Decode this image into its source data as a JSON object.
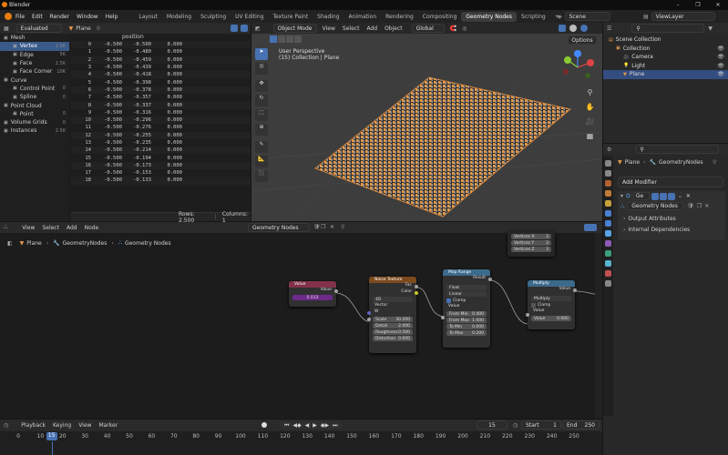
{
  "window": {
    "title": "Blender"
  },
  "menu": [
    "File",
    "Edit",
    "Render",
    "Window",
    "Help"
  ],
  "workspaces": [
    "Layout",
    "Modeling",
    "Sculpting",
    "UV Editing",
    "Texture Paint",
    "Shading",
    "Animation",
    "Rendering",
    "Compositing",
    "Geometry Nodes",
    "Scripting",
    "+"
  ],
  "active_workspace": "Geometry Nodes",
  "scene": "Scene",
  "view_layer": "ViewLayer",
  "spreadsheet": {
    "mode": "Evaluated",
    "object": "Plane",
    "column": "position",
    "side": [
      {
        "label": "Mesh",
        "count": "",
        "selected": false,
        "indent": 0
      },
      {
        "label": "Vertex",
        "count": "2.5K",
        "selected": true,
        "indent": 1
      },
      {
        "label": "Edge",
        "count": "5K",
        "selected": false,
        "indent": 1
      },
      {
        "label": "Face",
        "count": "2.5K",
        "selected": false,
        "indent": 1
      },
      {
        "label": "Face Corner",
        "count": "10K",
        "selected": false,
        "indent": 1
      },
      {
        "label": "Curve",
        "count": "",
        "selected": false,
        "indent": 0
      },
      {
        "label": "Control Point",
        "count": "0",
        "selected": false,
        "indent": 1
      },
      {
        "label": "Spline",
        "count": "0",
        "selected": false,
        "indent": 1
      },
      {
        "label": "Point Cloud",
        "count": "",
        "selected": false,
        "indent": 0
      },
      {
        "label": "Point",
        "count": "0",
        "selected": false,
        "indent": 1
      },
      {
        "label": "Volume Grids",
        "count": "0",
        "selected": false,
        "indent": 0
      },
      {
        "label": "Instances",
        "count": "2.5K",
        "selected": false,
        "indent": 0
      }
    ],
    "rows": [
      [
        "0",
        "-0.500",
        "-0.500",
        "0.000"
      ],
      [
        "1",
        "-0.500",
        "-0.480",
        "0.000"
      ],
      [
        "2",
        "-0.500",
        "-0.459",
        "0.000"
      ],
      [
        "3",
        "-0.500",
        "-0.439",
        "0.000"
      ],
      [
        "4",
        "-0.500",
        "-0.418",
        "0.000"
      ],
      [
        "5",
        "-0.500",
        "-0.398",
        "0.000"
      ],
      [
        "6",
        "-0.500",
        "-0.378",
        "0.000"
      ],
      [
        "7",
        "-0.500",
        "-0.357",
        "0.000"
      ],
      [
        "8",
        "-0.500",
        "-0.337",
        "0.000"
      ],
      [
        "9",
        "-0.500",
        "-0.316",
        "0.000"
      ],
      [
        "10",
        "-0.500",
        "-0.296",
        "0.000"
      ],
      [
        "11",
        "-0.500",
        "-0.276",
        "0.000"
      ],
      [
        "12",
        "-0.500",
        "-0.255",
        "0.000"
      ],
      [
        "13",
        "-0.500",
        "-0.235",
        "0.000"
      ],
      [
        "14",
        "-0.500",
        "-0.214",
        "0.000"
      ],
      [
        "15",
        "-0.500",
        "-0.194",
        "0.000"
      ],
      [
        "16",
        "-0.500",
        "-0.173",
        "0.000"
      ],
      [
        "17",
        "-0.500",
        "-0.153",
        "0.000"
      ],
      [
        "18",
        "-0.500",
        "-0.133",
        "0.000"
      ]
    ],
    "footer_rows": "Rows: 2,500",
    "footer_cols": "Columns: 1"
  },
  "viewport": {
    "mode": "Object Mode",
    "menus": [
      "View",
      "Select",
      "Add",
      "Object"
    ],
    "orientation": "Global",
    "options": "Options",
    "overlay_title": "User Perspective",
    "overlay_sub": "(15) Collection | Plane"
  },
  "outliner": {
    "items": [
      {
        "label": "Scene Collection",
        "indent": 0
      },
      {
        "label": "Collection",
        "indent": 1
      },
      {
        "label": "Camera",
        "indent": 2
      },
      {
        "label": "Light",
        "indent": 2
      },
      {
        "label": "Plane",
        "indent": 2,
        "selected": true
      }
    ]
  },
  "properties": {
    "breadcrumb_obj": "Plane",
    "breadcrumb_mod": "GeometryNodes",
    "add_modifier": "Add Modifier",
    "modifier_short": "Ge",
    "node_group": "Geometry Nodes",
    "panels": [
      "Output Attributes",
      "Internal Dependencies"
    ]
  },
  "node_editor": {
    "menus": [
      "View",
      "Select",
      "Add",
      "Node"
    ],
    "group": "Geometry Nodes",
    "breadcrumb": [
      "Plane",
      "GeometryNodes",
      "Geometry Nodes"
    ],
    "value_node": {
      "title": "Value",
      "label": "Value",
      "value": "0.033"
    },
    "noise_node": {
      "title": "Noise Texture",
      "out1": "Fac",
      "out2": "Color",
      "dim": "4D",
      "vector": "Vector",
      "w": "W",
      "fields": [
        [
          "Scale",
          "30.200"
        ],
        [
          "Detail",
          "2.000"
        ],
        [
          "Roughness",
          "0.500"
        ],
        [
          "Distortion",
          "0.000"
        ]
      ]
    },
    "map_node": {
      "title": "Map Range",
      "result": "Result",
      "type": "Float",
      "interp": "Linear",
      "clamp": "Clamp",
      "value": "Value",
      "fields": [
        [
          "From Min",
          "0.400"
        ],
        [
          "From Max",
          "1.000"
        ],
        [
          "To Min",
          "0.000"
        ],
        [
          "To Max",
          "0.200"
        ]
      ]
    },
    "mult_node": {
      "title": "Multiply",
      "out": "Value",
      "op": "Multiply",
      "clamp": "Clamp",
      "value": "Value",
      "val": "0.000"
    },
    "frame_node": {
      "rows": [
        [
          "Vertices X",
          "3"
        ],
        [
          "Vertices Y",
          "3"
        ],
        [
          "Vertices Z",
          "3"
        ]
      ]
    }
  },
  "timeline": {
    "menus": [
      "Playback",
      "Keying",
      "View",
      "Marker"
    ],
    "current": "15",
    "start_label": "Start",
    "start": "1",
    "end_label": "End",
    "end": "250",
    "ticks": [
      "0",
      "10",
      "20",
      "30",
      "40",
      "50",
      "60",
      "70",
      "80",
      "90",
      "100",
      "110",
      "120",
      "130",
      "140",
      "150",
      "160",
      "170",
      "180",
      "190",
      "200",
      "210",
      "220",
      "230",
      "240",
      "250"
    ]
  },
  "colors": {
    "accent": "#4772b3",
    "value_header": "#83314a",
    "texture_header": "#7d4a1e",
    "converter_header": "#3c6a8c",
    "cube": "#e59a4c"
  }
}
